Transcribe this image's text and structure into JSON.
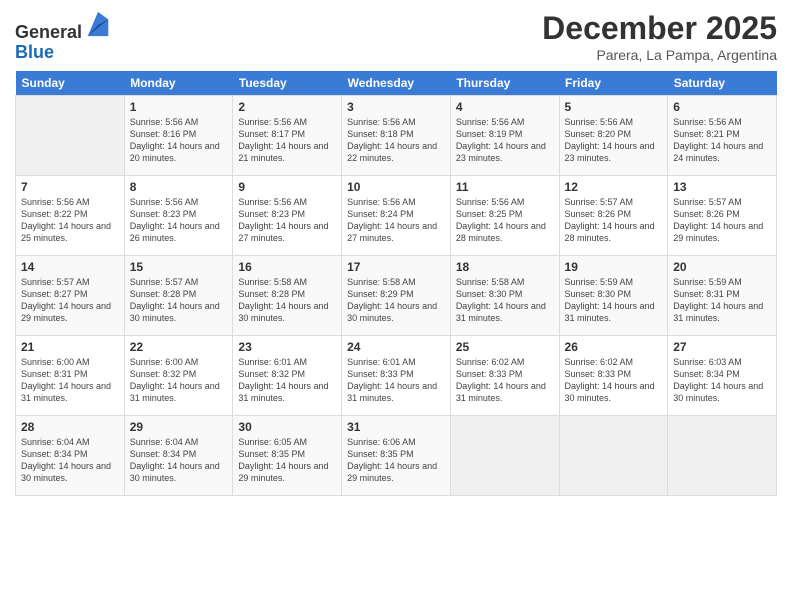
{
  "header": {
    "logo_general": "General",
    "logo_blue": "Blue",
    "month_title": "December 2025",
    "location": "Parera, La Pampa, Argentina"
  },
  "days_of_week": [
    "Sunday",
    "Monday",
    "Tuesday",
    "Wednesday",
    "Thursday",
    "Friday",
    "Saturday"
  ],
  "weeks": [
    [
      {
        "day": "",
        "empty": true
      },
      {
        "day": "1",
        "sunrise": "Sunrise: 5:56 AM",
        "sunset": "Sunset: 8:16 PM",
        "daylight": "Daylight: 14 hours and 20 minutes."
      },
      {
        "day": "2",
        "sunrise": "Sunrise: 5:56 AM",
        "sunset": "Sunset: 8:17 PM",
        "daylight": "Daylight: 14 hours and 21 minutes."
      },
      {
        "day": "3",
        "sunrise": "Sunrise: 5:56 AM",
        "sunset": "Sunset: 8:18 PM",
        "daylight": "Daylight: 14 hours and 22 minutes."
      },
      {
        "day": "4",
        "sunrise": "Sunrise: 5:56 AM",
        "sunset": "Sunset: 8:19 PM",
        "daylight": "Daylight: 14 hours and 23 minutes."
      },
      {
        "day": "5",
        "sunrise": "Sunrise: 5:56 AM",
        "sunset": "Sunset: 8:20 PM",
        "daylight": "Daylight: 14 hours and 23 minutes."
      },
      {
        "day": "6",
        "sunrise": "Sunrise: 5:56 AM",
        "sunset": "Sunset: 8:21 PM",
        "daylight": "Daylight: 14 hours and 24 minutes."
      }
    ],
    [
      {
        "day": "7",
        "sunrise": "Sunrise: 5:56 AM",
        "sunset": "Sunset: 8:22 PM",
        "daylight": "Daylight: 14 hours and 25 minutes."
      },
      {
        "day": "8",
        "sunrise": "Sunrise: 5:56 AM",
        "sunset": "Sunset: 8:23 PM",
        "daylight": "Daylight: 14 hours and 26 minutes."
      },
      {
        "day": "9",
        "sunrise": "Sunrise: 5:56 AM",
        "sunset": "Sunset: 8:23 PM",
        "daylight": "Daylight: 14 hours and 27 minutes."
      },
      {
        "day": "10",
        "sunrise": "Sunrise: 5:56 AM",
        "sunset": "Sunset: 8:24 PM",
        "daylight": "Daylight: 14 hours and 27 minutes."
      },
      {
        "day": "11",
        "sunrise": "Sunrise: 5:56 AM",
        "sunset": "Sunset: 8:25 PM",
        "daylight": "Daylight: 14 hours and 28 minutes."
      },
      {
        "day": "12",
        "sunrise": "Sunrise: 5:57 AM",
        "sunset": "Sunset: 8:26 PM",
        "daylight": "Daylight: 14 hours and 28 minutes."
      },
      {
        "day": "13",
        "sunrise": "Sunrise: 5:57 AM",
        "sunset": "Sunset: 8:26 PM",
        "daylight": "Daylight: 14 hours and 29 minutes."
      }
    ],
    [
      {
        "day": "14",
        "sunrise": "Sunrise: 5:57 AM",
        "sunset": "Sunset: 8:27 PM",
        "daylight": "Daylight: 14 hours and 29 minutes."
      },
      {
        "day": "15",
        "sunrise": "Sunrise: 5:57 AM",
        "sunset": "Sunset: 8:28 PM",
        "daylight": "Daylight: 14 hours and 30 minutes."
      },
      {
        "day": "16",
        "sunrise": "Sunrise: 5:58 AM",
        "sunset": "Sunset: 8:28 PM",
        "daylight": "Daylight: 14 hours and 30 minutes."
      },
      {
        "day": "17",
        "sunrise": "Sunrise: 5:58 AM",
        "sunset": "Sunset: 8:29 PM",
        "daylight": "Daylight: 14 hours and 30 minutes."
      },
      {
        "day": "18",
        "sunrise": "Sunrise: 5:58 AM",
        "sunset": "Sunset: 8:30 PM",
        "daylight": "Daylight: 14 hours and 31 minutes."
      },
      {
        "day": "19",
        "sunrise": "Sunrise: 5:59 AM",
        "sunset": "Sunset: 8:30 PM",
        "daylight": "Daylight: 14 hours and 31 minutes."
      },
      {
        "day": "20",
        "sunrise": "Sunrise: 5:59 AM",
        "sunset": "Sunset: 8:31 PM",
        "daylight": "Daylight: 14 hours and 31 minutes."
      }
    ],
    [
      {
        "day": "21",
        "sunrise": "Sunrise: 6:00 AM",
        "sunset": "Sunset: 8:31 PM",
        "daylight": "Daylight: 14 hours and 31 minutes."
      },
      {
        "day": "22",
        "sunrise": "Sunrise: 6:00 AM",
        "sunset": "Sunset: 8:32 PM",
        "daylight": "Daylight: 14 hours and 31 minutes."
      },
      {
        "day": "23",
        "sunrise": "Sunrise: 6:01 AM",
        "sunset": "Sunset: 8:32 PM",
        "daylight": "Daylight: 14 hours and 31 minutes."
      },
      {
        "day": "24",
        "sunrise": "Sunrise: 6:01 AM",
        "sunset": "Sunset: 8:33 PM",
        "daylight": "Daylight: 14 hours and 31 minutes."
      },
      {
        "day": "25",
        "sunrise": "Sunrise: 6:02 AM",
        "sunset": "Sunset: 8:33 PM",
        "daylight": "Daylight: 14 hours and 31 minutes."
      },
      {
        "day": "26",
        "sunrise": "Sunrise: 6:02 AM",
        "sunset": "Sunset: 8:33 PM",
        "daylight": "Daylight: 14 hours and 30 minutes."
      },
      {
        "day": "27",
        "sunrise": "Sunrise: 6:03 AM",
        "sunset": "Sunset: 8:34 PM",
        "daylight": "Daylight: 14 hours and 30 minutes."
      }
    ],
    [
      {
        "day": "28",
        "sunrise": "Sunrise: 6:04 AM",
        "sunset": "Sunset: 8:34 PM",
        "daylight": "Daylight: 14 hours and 30 minutes."
      },
      {
        "day": "29",
        "sunrise": "Sunrise: 6:04 AM",
        "sunset": "Sunset: 8:34 PM",
        "daylight": "Daylight: 14 hours and 30 minutes."
      },
      {
        "day": "30",
        "sunrise": "Sunrise: 6:05 AM",
        "sunset": "Sunset: 8:35 PM",
        "daylight": "Daylight: 14 hours and 29 minutes."
      },
      {
        "day": "31",
        "sunrise": "Sunrise: 6:06 AM",
        "sunset": "Sunset: 8:35 PM",
        "daylight": "Daylight: 14 hours and 29 minutes."
      },
      {
        "day": "",
        "empty": true
      },
      {
        "day": "",
        "empty": true
      },
      {
        "day": "",
        "empty": true
      }
    ]
  ]
}
